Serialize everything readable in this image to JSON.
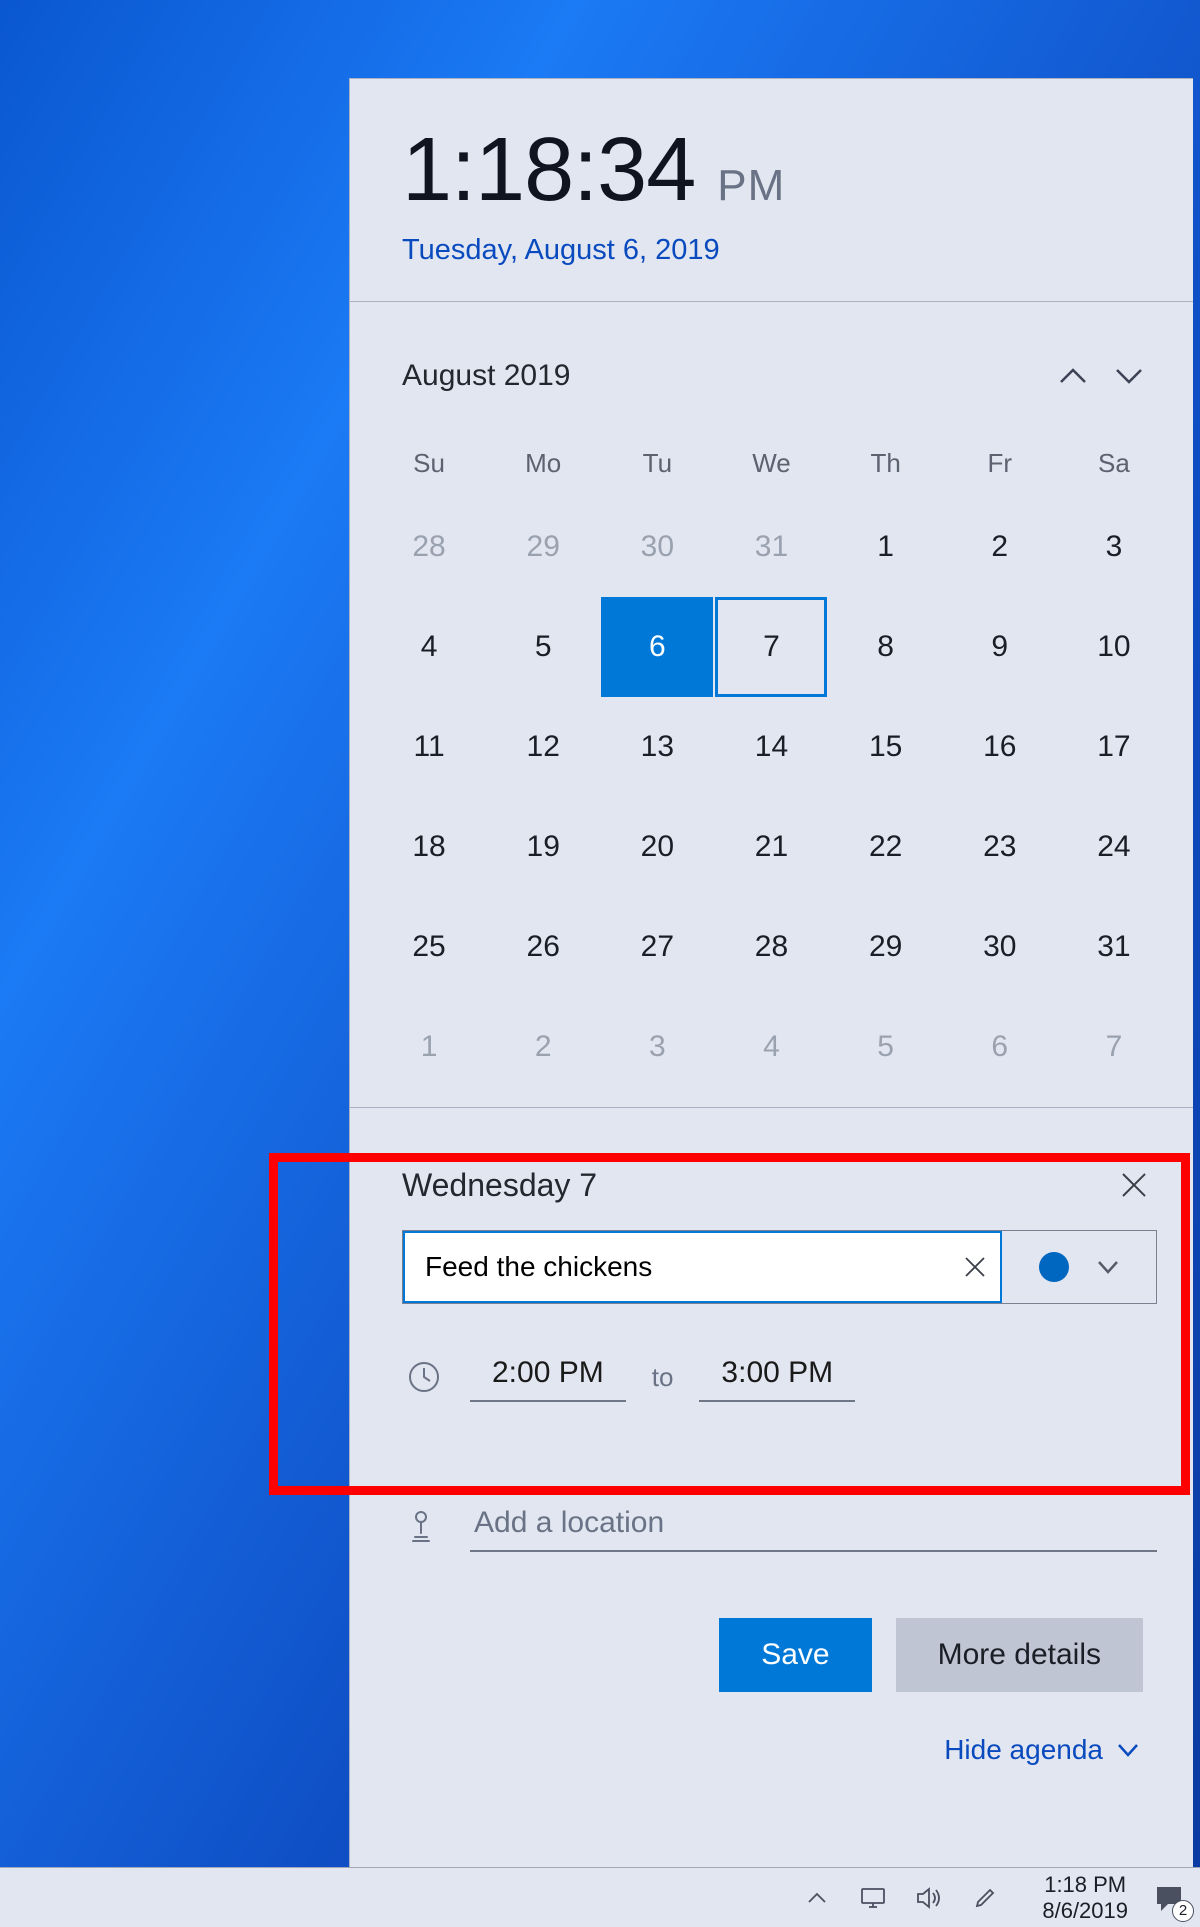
{
  "clock": {
    "time": "1:18:34",
    "ampm": "PM",
    "date_full": "Tuesday, August 6, 2019"
  },
  "calendar": {
    "month_label": "August 2019",
    "weekdays": [
      "Su",
      "Mo",
      "Tu",
      "We",
      "Th",
      "Fr",
      "Sa"
    ],
    "cells": [
      {
        "d": "28",
        "other": true
      },
      {
        "d": "29",
        "other": true
      },
      {
        "d": "30",
        "other": true
      },
      {
        "d": "31",
        "other": true
      },
      {
        "d": "1"
      },
      {
        "d": "2"
      },
      {
        "d": "3"
      },
      {
        "d": "4"
      },
      {
        "d": "5"
      },
      {
        "d": "6",
        "today": true
      },
      {
        "d": "7",
        "selected": true
      },
      {
        "d": "8"
      },
      {
        "d": "9"
      },
      {
        "d": "10"
      },
      {
        "d": "11"
      },
      {
        "d": "12"
      },
      {
        "d": "13"
      },
      {
        "d": "14"
      },
      {
        "d": "15"
      },
      {
        "d": "16"
      },
      {
        "d": "17"
      },
      {
        "d": "18"
      },
      {
        "d": "19"
      },
      {
        "d": "20"
      },
      {
        "d": "21"
      },
      {
        "d": "22"
      },
      {
        "d": "23"
      },
      {
        "d": "24"
      },
      {
        "d": "25"
      },
      {
        "d": "26"
      },
      {
        "d": "27"
      },
      {
        "d": "28"
      },
      {
        "d": "29"
      },
      {
        "d": "30"
      },
      {
        "d": "31"
      },
      {
        "d": "1",
        "other": true
      },
      {
        "d": "2",
        "other": true
      },
      {
        "d": "3",
        "other": true
      },
      {
        "d": "4",
        "other": true
      },
      {
        "d": "5",
        "other": true
      },
      {
        "d": "6",
        "other": true
      },
      {
        "d": "7",
        "other": true
      }
    ]
  },
  "event": {
    "date_label": "Wednesday 7",
    "title_value": "Feed the chickens",
    "start_time": "2:00 PM",
    "to_label": "to",
    "end_time": "3:00 PM",
    "location_placeholder": "Add a location",
    "save_label": "Save",
    "more_label": "More details"
  },
  "hide_agenda_label": "Hide agenda",
  "taskbar": {
    "clock_time": "1:18 PM",
    "clock_date": "8/6/2019",
    "notif_count": "2"
  }
}
